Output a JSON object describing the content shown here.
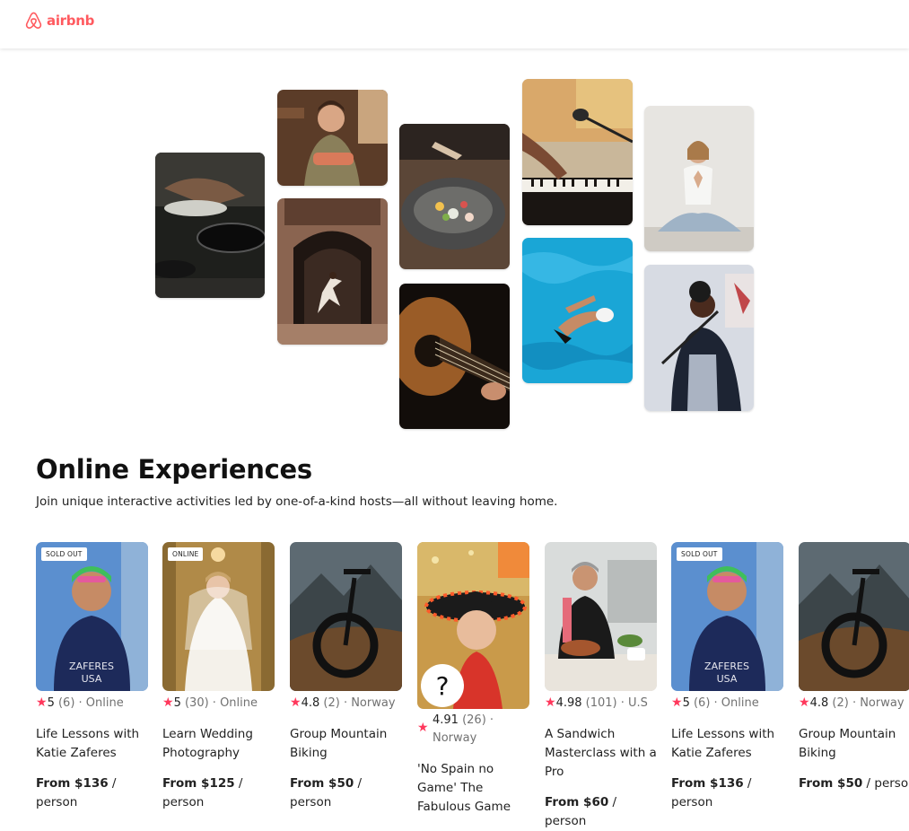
{
  "header": {
    "logo_text": "airbnb"
  },
  "collage": [
    {
      "name": "collage-cooking-photo",
      "icon": "cooking-pans-photo"
    },
    {
      "name": "collage-baker-photo",
      "icon": "woman-holding-pastries-photo"
    },
    {
      "name": "collage-dancer-photo",
      "icon": "dancer-in-doorway-photo"
    },
    {
      "name": "collage-food-bowl-photo",
      "icon": "food-bowl-photo"
    },
    {
      "name": "collage-guitar-photo",
      "icon": "acoustic-guitar-photo"
    },
    {
      "name": "collage-piano-mic-photo",
      "icon": "piano-microphone-photo"
    },
    {
      "name": "collage-swimmer-photo",
      "icon": "swimmer-pool-photo"
    },
    {
      "name": "collage-yoga-photo",
      "icon": "yoga-woman-photo"
    },
    {
      "name": "collage-singer-photo",
      "icon": "singer-microphone-photo"
    }
  ],
  "section": {
    "title": "Online Experiences",
    "subtitle": "Join unique interactive activities led by one-of-a-kind hosts—all without leaving home."
  },
  "cards": [
    {
      "badge": "SOLD OUT",
      "rating": "5",
      "reviews": "(6)",
      "location": " · Online",
      "title": "Life Lessons with Katie Zaferes",
      "price": "From $136",
      "per": " / person"
    },
    {
      "badge": "ONLINE",
      "rating": "5",
      "reviews": "(30)",
      "location": " · Online",
      "title": "Learn Wedding Photography",
      "price": "From $125",
      "per": " / person"
    },
    {
      "badge": "",
      "rating": "4.8",
      "reviews": "(2)",
      "location": " · Norway",
      "title": "Group Mountain Biking",
      "price": "From $50",
      "per": " / person"
    },
    {
      "badge": "",
      "rating": "4.91",
      "reviews": "(26)",
      "location": " · Norway",
      "title": "'No Spain no Game' The Fabulous Game",
      "price": "",
      "per": ""
    },
    {
      "badge": "",
      "rating": "4.98",
      "reviews": "(101)",
      "location": " · U.S",
      "title": "A Sandwich Masterclass with a Pro",
      "price": "From $60",
      "per": " / person"
    },
    {
      "badge": "SOLD OUT",
      "rating": "5",
      "reviews": "(6)",
      "location": " · Online",
      "title": "Life Lessons with Katie Zaferes",
      "price": "From $136",
      "per": " / person"
    },
    {
      "badge": "",
      "rating": "4.8",
      "reviews": "(2)",
      "location": " · Norway",
      "title": "Group Mountain Biking",
      "price": "From $50",
      "per": " / person"
    }
  ],
  "colors": {
    "brand": "#ff5a5f",
    "star": "#ff385c",
    "muted": "#717171"
  }
}
